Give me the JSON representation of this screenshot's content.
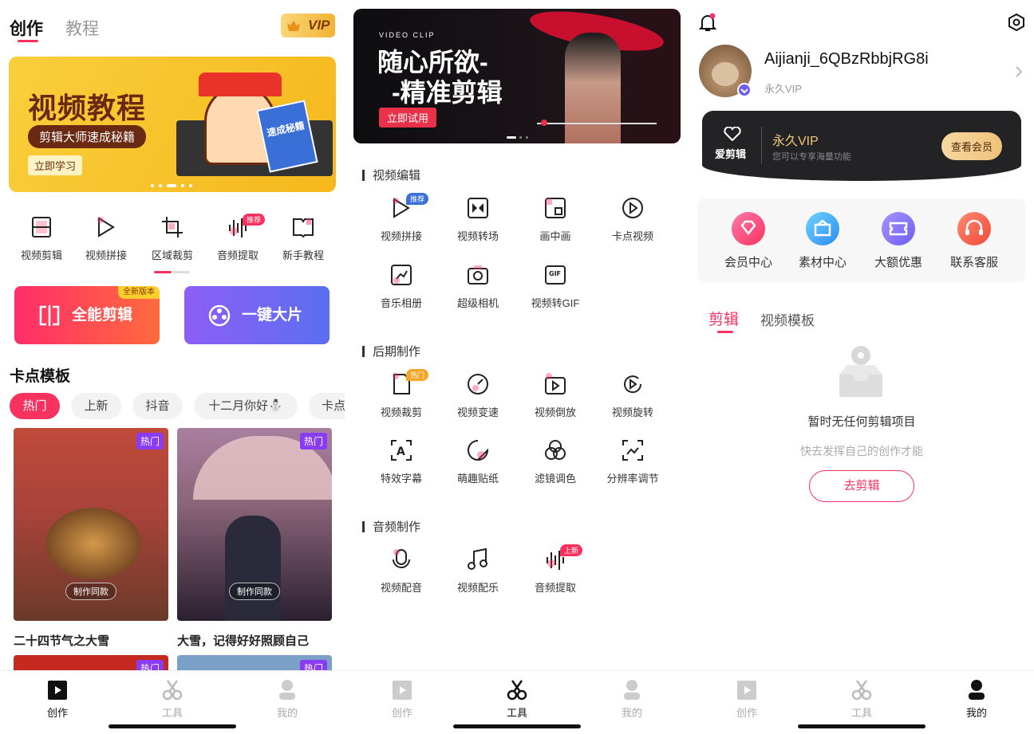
{
  "colors": {
    "accent": "#f7325f",
    "purple": "#6c5df0",
    "gold": "#f5b62a"
  },
  "p1": {
    "tabs": [
      "创作",
      "教程"
    ],
    "vip": "VIP",
    "banner": {
      "title": "视频教程",
      "subtitle": "剪辑大师速成秘籍",
      "cta": "立即学习",
      "book": "速成秘籍"
    },
    "tools": [
      {
        "label": "视频剪辑",
        "icon": "film-icon"
      },
      {
        "label": "视频拼接",
        "icon": "play-join-icon"
      },
      {
        "label": "区域裁剪",
        "icon": "crop-icon"
      },
      {
        "label": "音频提取",
        "icon": "audio-wave-icon",
        "badge": "推荐"
      },
      {
        "label": "新手教程",
        "icon": "book-icon"
      }
    ],
    "big": [
      {
        "label": "全能剪辑",
        "badge": "全新版本"
      },
      {
        "label": "一键大片"
      }
    ],
    "section": "卡点模板",
    "chips": [
      "热门",
      "上新",
      "抖音",
      "十二月你好⛄",
      "卡点"
    ],
    "cards": [
      {
        "badge": "热门",
        "button": "制作同款",
        "title": "二十四节气之大雪"
      },
      {
        "badge": "热门",
        "button": "制作同款",
        "title": "大雪，记得好好照顾自己"
      }
    ],
    "more_badges": [
      "热门",
      "热门"
    ]
  },
  "p2": {
    "banner": {
      "small": "VIDEO CLIP",
      "line1": "随心所欲-",
      "line2": "-精准剪辑",
      "cta": "立即试用"
    },
    "sections": [
      {
        "title": "视频编辑",
        "items": [
          {
            "label": "视频拼接",
            "badge": "推荐"
          },
          {
            "label": "视频转场"
          },
          {
            "label": "画中画"
          },
          {
            "label": "卡点视频"
          },
          {
            "label": "音乐相册"
          },
          {
            "label": "超级相机"
          },
          {
            "label": "视频转GIF"
          }
        ]
      },
      {
        "title": "后期制作",
        "items": [
          {
            "label": "视频裁剪",
            "badge": "热门"
          },
          {
            "label": "视频变速"
          },
          {
            "label": "视频倒放"
          },
          {
            "label": "视频旋转"
          },
          {
            "label": "特效字幕"
          },
          {
            "label": "萌趣贴纸"
          },
          {
            "label": "滤镜调色"
          },
          {
            "label": "分辨率调节"
          }
        ]
      },
      {
        "title": "音频制作",
        "items": [
          {
            "label": "视频配音"
          },
          {
            "label": "视频配乐"
          },
          {
            "label": "音频提取",
            "badge": "上新"
          }
        ]
      }
    ]
  },
  "p3": {
    "username": "Aijianji_6QBzRbbjRG8i",
    "vip_status": "永久VIP",
    "card": {
      "brand": "爱剪辑",
      "title": "永久VIP",
      "desc": "您可以专享海量功能",
      "button": "查看会员"
    },
    "menu": [
      "会员中心",
      "素材中心",
      "大额优惠",
      "联系客服"
    ],
    "tabs": [
      "剪辑",
      "视频模板"
    ],
    "empty": {
      "title": "暂时无任何剪辑项目",
      "sub": "快去发挥自己的创作才能",
      "button": "去剪辑"
    }
  },
  "nav": [
    "创作",
    "工具",
    "我的"
  ]
}
